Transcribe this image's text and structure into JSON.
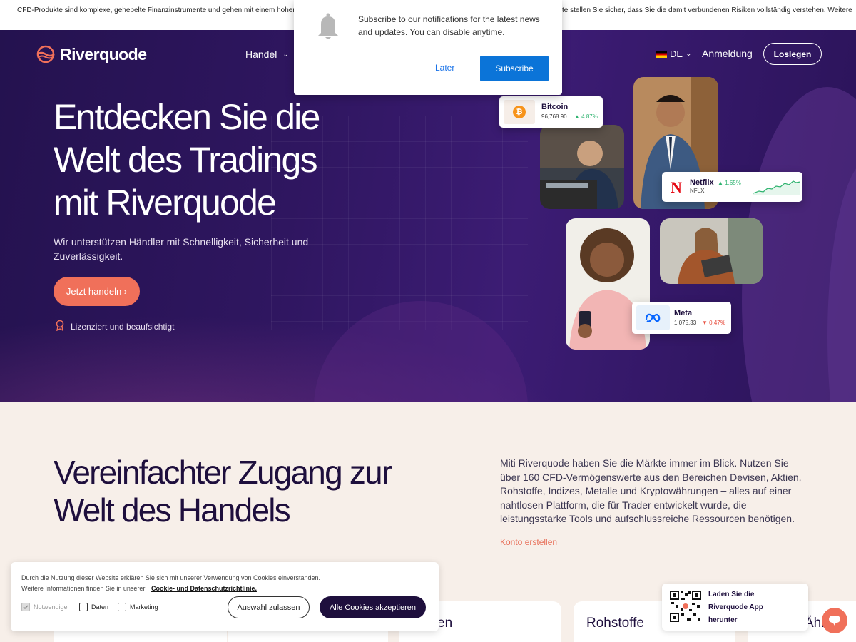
{
  "risk_banner": {
    "left_text": "CFD-Produkte sind komplexe, gehebelte Finanzinstrumente und gehen mit einem hohen Risi",
    "right_text": "te stellen Sie sicher, dass Sie die damit verbundenen Risiken vollständig verstehen. Weitere"
  },
  "notification": {
    "message": "Subscribe to our notifications for the latest news and updates. You can disable anytime.",
    "later_label": "Later",
    "subscribe_label": "Subscribe",
    "icon": "bell-icon"
  },
  "header": {
    "logo_text": "Riverquode",
    "nav_handel": "Handel",
    "language": "DE",
    "login_label": "Anmeldung",
    "start_label": "Losslegen"
  },
  "hero": {
    "title": "Entdecken Sie die Welt des Tradings mit Riverquode",
    "subtitle": "Wir unterstützen Händler mit Schnelligkeit, Sicherheit und Zuverlässigkeit.",
    "cta_label": "Jetzt handeln ›",
    "licensed_label": "Lizenziert und beaufsichtigt",
    "cards": {
      "bitcoin": {
        "name": "Bitcoin",
        "value": "96,768.90",
        "change": "▲ 4.87%"
      },
      "netflix": {
        "name": "Netflix",
        "ticker": "NFLX",
        "change": "▲ 1.65%"
      },
      "meta": {
        "name": "Meta",
        "value": "1,075.33",
        "change": "▼ 0.47%"
      }
    }
  },
  "section2": {
    "heading": "Vereinfachter Zugang zur Welt des Handels",
    "paragraph": "Miti Riverquode haben Sie die Märkte immer im Blick. Nutzen Sie über 160 CFD-Vermögenswerte aus den Bereichen Devisen, Aktien, Rohstoffe, Indizes, Metalle und Kryptowährungen – alles auf einer nahtlosen Plattform, die für Trader entwickelt wurde, die leistungsstarke Tools und aufschlussreiche Ressourcen benötigen.",
    "link_label": "Konto erstellen",
    "tiles": [
      "en",
      "Rohstoffe",
      "Ähnge"
    ]
  },
  "cookie": {
    "text_line1": "Durch die Nutzung dieser Website erklären Sie sich mit unserer Verwendung von Cookies einverstanden.",
    "text_line2": "Weitere Informationen finden Sie in unserer",
    "link_label": "Cookie- und Datenschutzrichtlinie.",
    "options": [
      "Notwendige",
      "Daten",
      "Marketing"
    ],
    "btn_selection": "Auswahl zulassen",
    "btn_accept": "Alle Cookies akzeptieren"
  },
  "app_promo": {
    "text": "Laden Sie die Riverquode App herunter"
  },
  "colors": {
    "hero_bg": "#2f1660",
    "accent": "#f0705a",
    "dark": "#1e0f3d",
    "subscribe_blue": "#0b74d8"
  }
}
